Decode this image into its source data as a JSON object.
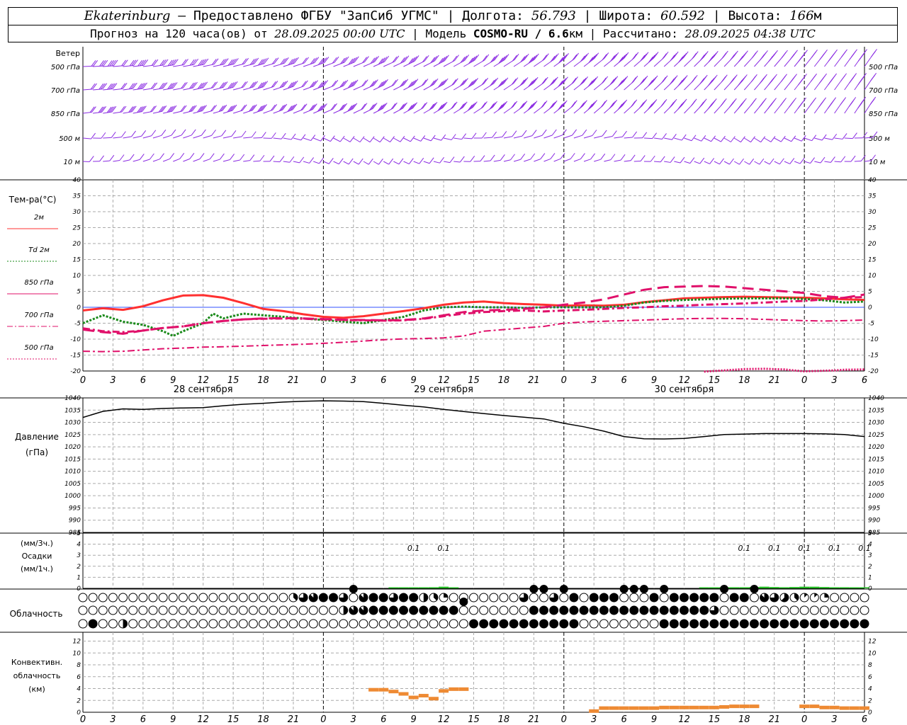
{
  "header": {
    "city": "Ekaterinburg",
    "provider": "Предоставлено ФГБУ \"ЗапСиб УГМС\"",
    "lon_label": "Долгота:",
    "lon_value": "56.793",
    "lat_label": "Широта:",
    "lat_value": "60.592",
    "alt_label": "Высота:",
    "alt_value": "166",
    "alt_unit": "м",
    "forecast_prefix": "Прогноз на 120 часа(ов) от",
    "forecast_time": "28.09.2025 00:00 UTC",
    "model_label": "Модель",
    "model_name": "COSMO-RU / 6.6",
    "model_unit": "км",
    "calc_label": "Рассчитано:",
    "calc_time": "28.09.2025 04:38 UTC"
  },
  "panels": {
    "wind": {
      "title": "Ветер",
      "levels": [
        "500 гПа",
        "700 гПа",
        "850 гПа",
        "500 м",
        "10  м"
      ]
    },
    "temp": {
      "title": "Тем-ра(°C)",
      "legend": [
        {
          "label": "2м",
          "color": "#ff3030",
          "style": "solid"
        },
        {
          "label": "Td  2м",
          "color": "#1a8a1a",
          "style": "dotted"
        },
        {
          "label": "850  гПа",
          "color": "#e0106a",
          "style": "solid"
        },
        {
          "label": "700  гПа",
          "color": "#e0106a",
          "style": "dashdot"
        },
        {
          "label": "500  гПа",
          "color": "#e0106a",
          "style": "dotted"
        }
      ],
      "yticks": [
        "40",
        "35",
        "30",
        "25",
        "20",
        "15",
        "10",
        "5",
        "0",
        "-5",
        "-10",
        "-15",
        "-20"
      ]
    },
    "pressure": {
      "title": "Давление",
      "unit": "(гПа)",
      "yticks": [
        "1040",
        "1035",
        "1030",
        "1025",
        "1020",
        "1015",
        "1010",
        "1005",
        "1000",
        "995",
        "990",
        "985"
      ]
    },
    "precip": {
      "title_top": "(мм/3ч.)",
      "title": "Осадки",
      "title_bottom": "(мм/1ч.)",
      "yticks": [
        "5",
        "4",
        "3",
        "2",
        "1",
        "0"
      ],
      "labels": [
        {
          "hour": 33,
          "text": "0.1"
        },
        {
          "hour": 36,
          "text": "0.1"
        },
        {
          "hour": 66,
          "text": "0.1"
        },
        {
          "hour": 69,
          "text": "0.1"
        },
        {
          "hour": 72,
          "text": "0.1"
        },
        {
          "hour": 75,
          "text": "0.1"
        },
        {
          "hour": 78,
          "text": "0.1"
        }
      ]
    },
    "cloud": {
      "title": "Облачность"
    },
    "conv": {
      "title_1": "Конвективн.",
      "title_2": "облачность",
      "title_3": "(км)",
      "yticks": [
        "12",
        "10",
        "8",
        "6",
        "4",
        "2",
        "0"
      ]
    }
  },
  "x_tick_labels": [
    "0",
    "3",
    "6",
    "9",
    "12",
    "15",
    "18",
    "21",
    "0",
    "3",
    "6",
    "9",
    "12",
    "15",
    "18",
    "21",
    "0",
    "3",
    "6",
    "9",
    "12",
    "15",
    "18",
    "21",
    "0",
    "3",
    "6"
  ],
  "date_labels": [
    {
      "hour": 12,
      "text": "28 сентября"
    },
    {
      "hour": 36,
      "text": "29 сентября"
    },
    {
      "hour": 60,
      "text": "30 сентября"
    }
  ],
  "chart_data": [
    {
      "type": "line",
      "title": "Тем-ра(°C)",
      "x_unit": "hours from 28.09.2025 00:00 UTC",
      "xlim": [
        0,
        78
      ],
      "ylim": [
        -20,
        40
      ],
      "series": [
        {
          "name": "2м",
          "color": "#ff3030",
          "x": [
            0,
            2,
            4,
            6,
            8,
            10,
            12,
            14,
            16,
            18,
            20,
            22,
            24,
            26,
            28,
            30,
            32,
            34,
            36,
            38,
            40,
            42,
            44,
            46,
            48,
            50,
            52,
            54,
            56,
            58,
            60,
            62,
            64,
            66,
            68,
            70,
            72,
            74,
            76,
            78
          ],
          "y": [
            -1,
            -0.3,
            -0.8,
            0.3,
            2.2,
            3.7,
            3.8,
            3,
            1.3,
            -0.5,
            -1.2,
            -2.2,
            -3,
            -3.3,
            -2.8,
            -2,
            -1.2,
            -0.3,
            0.8,
            1.5,
            1.8,
            1.3,
            1,
            0.8,
            0.5,
            0.6,
            0.5,
            0.8,
            1.6,
            2.2,
            2.8,
            3,
            3.2,
            3.3,
            3.2,
            3.1,
            3,
            2.8,
            2.5,
            2.3
          ]
        },
        {
          "name": "Td  2м",
          "color": "#1a8a1a",
          "x": [
            0,
            2,
            4,
            6,
            8,
            9,
            10,
            12,
            13,
            14,
            16,
            18,
            20,
            22,
            24,
            26,
            28,
            30,
            32,
            34,
            36,
            38,
            40,
            42,
            44,
            46,
            48,
            50,
            52,
            54,
            56,
            58,
            60,
            62,
            64,
            66,
            68,
            70,
            72,
            74,
            76,
            78
          ],
          "y": [
            -5,
            -2.5,
            -4.5,
            -5.5,
            -7.5,
            -9,
            -7.5,
            -5,
            -2,
            -3.5,
            -2,
            -2.5,
            -3,
            -3.5,
            -4,
            -4.5,
            -5,
            -4,
            -3,
            -1,
            0,
            0.2,
            0,
            0,
            -0.2,
            0,
            0,
            0,
            0,
            0.5,
            1.5,
            2,
            2.3,
            2.5,
            2.7,
            2.8,
            2.8,
            2.8,
            2.6,
            2.2,
            1.5,
            1.8
          ]
        },
        {
          "name": "850  гПа",
          "color": "#e0106a",
          "x": [
            0,
            2,
            4,
            6,
            8,
            10,
            12,
            14,
            16,
            18,
            20,
            22,
            24,
            26,
            28,
            30,
            32,
            34,
            36,
            38,
            40,
            42,
            44,
            46,
            48,
            50,
            52,
            54,
            56,
            58,
            60,
            62,
            64,
            66,
            68,
            70,
            72,
            74,
            76,
            78
          ],
          "y": [
            -7,
            -7.8,
            -8.3,
            -7.3,
            -6.5,
            -6,
            -5,
            -4.3,
            -3.8,
            -3.5,
            -3.4,
            -3.5,
            -3.7,
            -3.9,
            -4,
            -4.1,
            -4,
            -3.5,
            -2.5,
            -1.5,
            -1,
            -0.8,
            -0.5,
            0,
            0.8,
            1.5,
            2.5,
            4,
            5.5,
            6.3,
            6.5,
            6.7,
            6.5,
            6,
            5.5,
            5,
            4.5,
            3.5,
            3,
            4
          ]
        },
        {
          "name": "700  гПа",
          "color": "#e0106a",
          "x": [
            0,
            2,
            4,
            6,
            8,
            10,
            12,
            14,
            16,
            18,
            20,
            22,
            24,
            26,
            28,
            30,
            32,
            34,
            36,
            38,
            40,
            42,
            44,
            46,
            48,
            50,
            52,
            54,
            56,
            58,
            60,
            62,
            64,
            66,
            68,
            70,
            72,
            74,
            76,
            78
          ],
          "y": [
            -6.6,
            -7.5,
            -7.8,
            -7.3,
            -6.5,
            -6,
            -5,
            -4.3,
            -3.8,
            -3.6,
            -3.5,
            -3.6,
            -3.8,
            -4,
            -4.1,
            -4.2,
            -4.1,
            -3.6,
            -2.8,
            -2,
            -1.5,
            -1.2,
            -1,
            -1.3,
            -1,
            -0.8,
            -0.5,
            -0.2,
            0,
            0.3,
            0.5,
            0.8,
            1,
            1.2,
            1.5,
            1.8,
            2,
            2.5,
            3,
            3.2
          ]
        },
        {
          "name": "500  гПа",
          "color": "#e0106a",
          "x": [
            0,
            2,
            4,
            6,
            8,
            10,
            12,
            14,
            16,
            18,
            20,
            22,
            24,
            26,
            28,
            30,
            32,
            34,
            36,
            38,
            40,
            42,
            44,
            46,
            48,
            50,
            52,
            54,
            56,
            58,
            60,
            62,
            64,
            66,
            68,
            70,
            72,
            74,
            76,
            78
          ],
          "y": [
            -13.8,
            -13.9,
            -13.8,
            -13.4,
            -13,
            -12.8,
            -12.5,
            -12.4,
            -12.2,
            -12,
            -11.8,
            -11.6,
            -11.3,
            -11,
            -10.6,
            -10.2,
            -9.9,
            -9.8,
            -9.6,
            -9,
            -7.5,
            -7,
            -6.5,
            -6,
            -5,
            -4.6,
            -4.4,
            -4.2,
            -4,
            -3.8,
            -3.6,
            -3.5,
            -3.5,
            -3.6,
            -3.8,
            -4,
            -4.2,
            -4.3,
            -4.2,
            -4
          ]
        },
        {
          "name": "500 hPa (lower scale)",
          "color": "#e0106a",
          "x": [
            62,
            64,
            66,
            68,
            70,
            72,
            75,
            76,
            78
          ],
          "y": [
            -20.2,
            -19.8,
            -19.4,
            -19.3,
            -19.5,
            -20.1,
            -19.8,
            -19.6,
            -19.5
          ]
        }
      ]
    },
    {
      "type": "line",
      "title": "Давление",
      "ylabel": "(гПа)",
      "xlim": [
        0,
        78
      ],
      "ylim": [
        985,
        1040
      ],
      "series": [
        {
          "name": "Давление",
          "x": [
            0,
            2,
            4,
            6,
            8,
            10,
            12,
            14,
            16,
            18,
            20,
            22,
            24,
            26,
            28,
            30,
            32,
            34,
            36,
            38,
            40,
            42,
            44,
            46,
            48,
            50,
            52,
            54,
            56,
            58,
            60,
            62,
            64,
            66,
            68,
            70,
            72,
            74,
            76,
            78
          ],
          "y": [
            1032,
            1034.5,
            1035.5,
            1035.3,
            1035.7,
            1035.9,
            1036,
            1036.8,
            1037.4,
            1037.8,
            1038.3,
            1038.6,
            1038.8,
            1038.7,
            1038.5,
            1037.8,
            1037,
            1036.3,
            1035.3,
            1034.4,
            1033.6,
            1032.8,
            1032.1,
            1031.4,
            1029.6,
            1028.2,
            1026.4,
            1024.2,
            1023.3,
            1023.2,
            1023.4,
            1024.2,
            1025,
            1025.2,
            1025.4,
            1025.4,
            1025.4,
            1025.3,
            1025,
            1024.2
          ]
        }
      ]
    },
    {
      "type": "bar",
      "title": "Осадки",
      "ylabel": "(мм/1ч.)",
      "xlim": [
        0,
        78
      ],
      "ylim": [
        0,
        5
      ],
      "series": [
        {
          "name": "Осадки",
          "x": [
            31,
            32,
            33,
            34,
            35,
            36,
            37,
            62,
            63,
            64,
            65,
            66,
            67,
            68,
            69,
            70,
            71,
            72,
            73,
            74,
            75,
            76,
            77,
            78
          ],
          "y": [
            0.02,
            0.03,
            0.05,
            0.03,
            0.1,
            0.15,
            0.05,
            0.05,
            0.08,
            0.1,
            0.1,
            0.1,
            0.12,
            0.15,
            0.12,
            0.1,
            0.12,
            0.15,
            0.15,
            0.12,
            0.1,
            0.1,
            0.08,
            0.08
          ]
        }
      ]
    },
    {
      "type": "table",
      "title": "Облачность",
      "x_step_hours": 1,
      "rows": [
        "000000000000000000000367896879869843200000006886890988888988889989987653112000000000",
        "0000000000000000000000000047799999999980000009999999899999999996000000000000000000000",
        "0800400000000000000000000000000000000009999999999900000000999999999999999999999999999"
      ]
    },
    {
      "type": "bar",
      "title": "Конвективн.",
      "ylabel": "(км)",
      "xlim": [
        0,
        78
      ],
      "ylim": [
        0,
        12
      ],
      "series": [
        {
          "name": "Конвективн.",
          "x": [
            29,
            30,
            31,
            32,
            33,
            34,
            35,
            36,
            37,
            38,
            51,
            52,
            53,
            54,
            55,
            56,
            57,
            58,
            59,
            60,
            61,
            62,
            63,
            64,
            65,
            66,
            67,
            72,
            73,
            74,
            75,
            76,
            77,
            78
          ],
          "y": [
            3.8,
            3.8,
            3.5,
            3.1,
            2.5,
            2.8,
            2.3,
            3.6,
            3.9,
            3.9,
            0.2,
            0.7,
            0.7,
            0.7,
            0.7,
            0.7,
            0.7,
            0.8,
            0.8,
            0.8,
            0.8,
            0.8,
            0.8,
            0.9,
            1,
            1,
            1,
            1,
            1,
            0.8,
            0.8,
            0.7,
            0.7,
            0.7
          ]
        }
      ]
    }
  ]
}
